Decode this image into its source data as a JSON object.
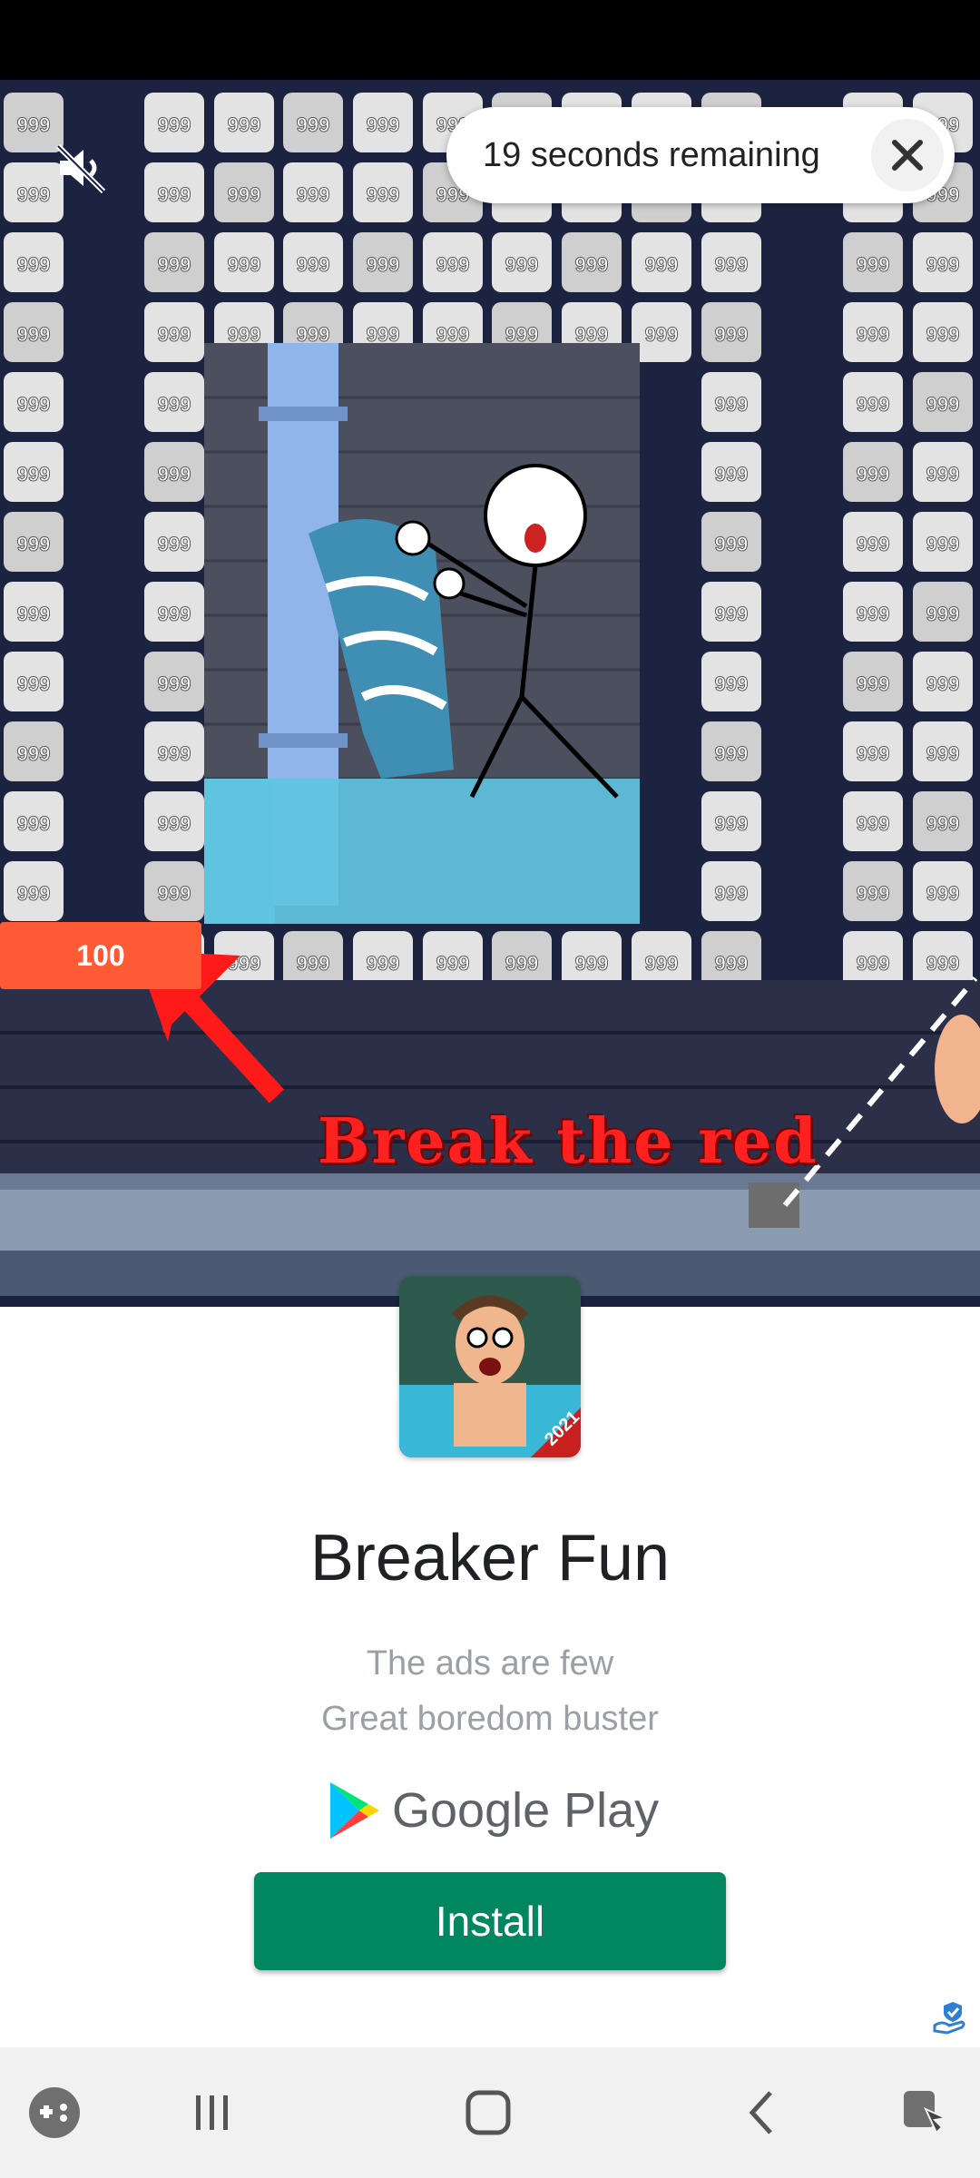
{
  "ad": {
    "timer_text": "19 seconds remaining",
    "overlay_text": "Break the red",
    "hp_value": "100",
    "tile_value": "999",
    "icon_badge": "2021",
    "app_title": "Breaker Fun",
    "taglines": [
      "The ads are few",
      "Great boredom buster"
    ],
    "store_name": "Google Play",
    "install_label": "Install"
  },
  "icons": {
    "mute": "volume-muted-icon",
    "close": "close-icon",
    "store": "google-play-icon",
    "adchoices": "ad-choices-icon",
    "nav": [
      "game-launcher-icon",
      "recent-apps-icon",
      "home-icon",
      "back-icon",
      "accessibility-icon"
    ]
  },
  "colors": {
    "install": "#01875f",
    "background_game": "#1c2340",
    "highlight_red": "#ff5a36"
  }
}
